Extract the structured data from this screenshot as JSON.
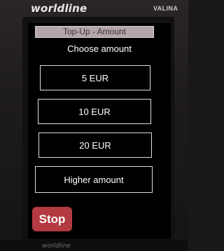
{
  "device": {
    "brand": "worldline",
    "model": "VALINA",
    "footer_brand": "worldline"
  },
  "screen": {
    "title": "Top-Up - Amount",
    "prompt": "Choose amount",
    "options": [
      {
        "label": "5 EUR"
      },
      {
        "label": "10 EUR"
      },
      {
        "label": "20 EUR"
      },
      {
        "label": "Higher amount"
      }
    ],
    "stop_label": "Stop"
  },
  "colors": {
    "header_bg": "#b3a6ad",
    "stop_bg": "#b23a40",
    "button_border": "#d7dde2",
    "screen_bg": "#000000"
  }
}
